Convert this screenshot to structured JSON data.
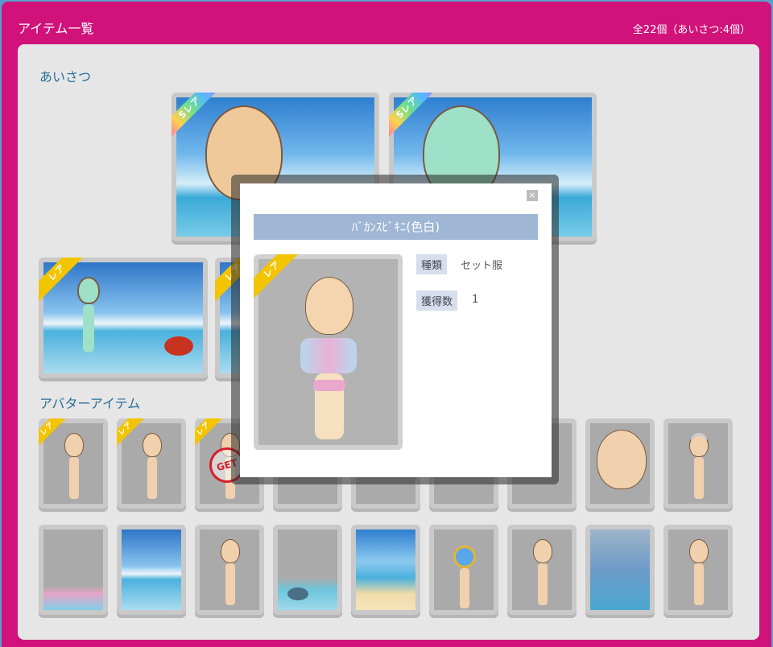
{
  "header": {
    "title": "アイテム一覧",
    "count": "全22個（あいさつ:4個）"
  },
  "sections": {
    "greetings": "あいさつ",
    "avatar_items": "アバターアイテム"
  },
  "badges": {
    "super_rare": "Sレア",
    "rare": "レア",
    "get_stamp": "GET"
  },
  "dialog": {
    "close_icon": "×",
    "title": "ﾊﾞｶﾝｽﾋﾞｷﾆ(色白)",
    "attrs": [
      {
        "key": "種類",
        "value": "セット服"
      },
      {
        "key": "獲得数",
        "value": "1"
      }
    ]
  },
  "colors": {
    "frame": "#d0127a",
    "panel": "#e6e6e6",
    "section_label": "#2a6f9a",
    "dialog_title_bg": "#9fb7d5",
    "rare_ribbon": "#f3c400"
  }
}
